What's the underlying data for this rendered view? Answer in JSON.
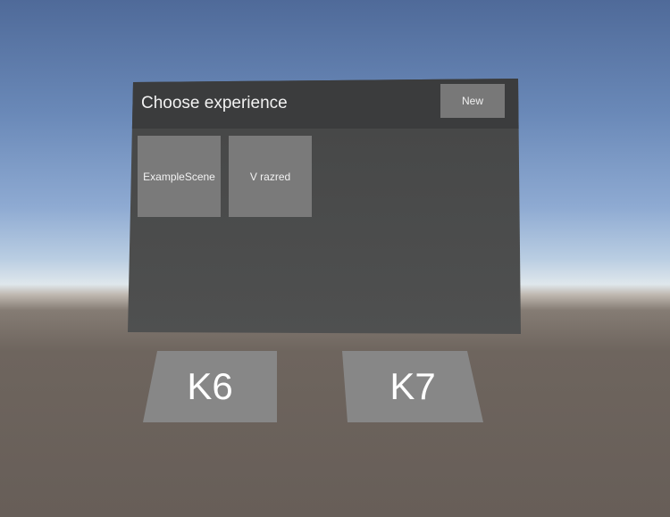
{
  "panel": {
    "title": "Choose experience",
    "new_button_label": "New",
    "tiles": [
      {
        "label": "ExampleScene"
      },
      {
        "label": "V razred"
      }
    ]
  },
  "floor_buttons": [
    {
      "label": "K6"
    },
    {
      "label": "K7"
    }
  ]
}
